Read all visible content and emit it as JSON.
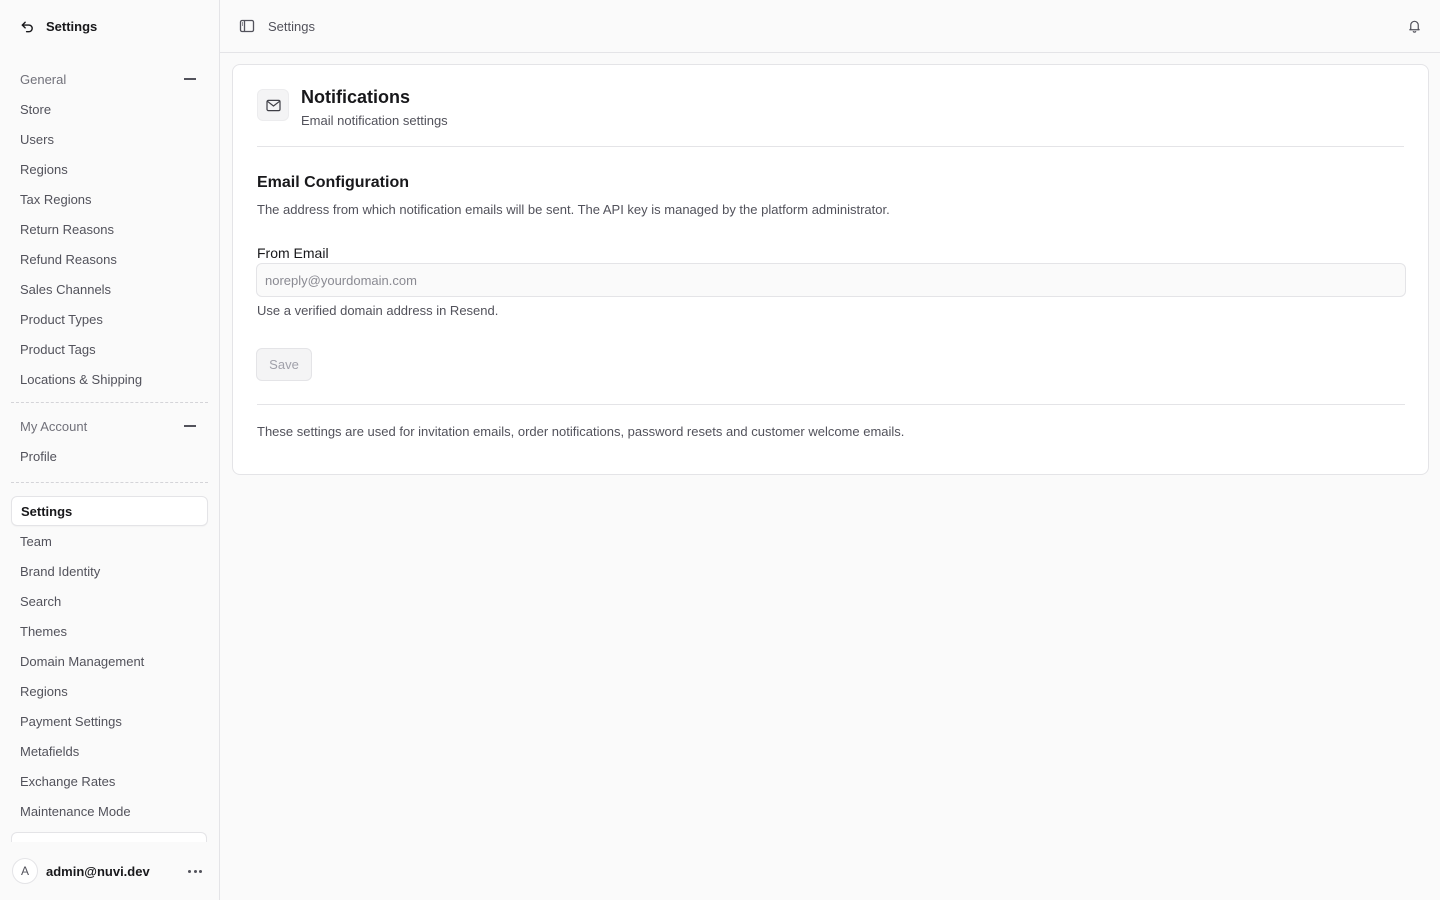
{
  "sidebar": {
    "title": "Settings",
    "groups": [
      {
        "label": "General",
        "items": [
          "Store",
          "Users",
          "Regions",
          "Tax Regions",
          "Return Reasons",
          "Refund Reasons",
          "Sales Channels",
          "Product Types",
          "Product Tags",
          "Locations & Shipping"
        ]
      },
      {
        "label": "My Account",
        "items": [
          "Profile"
        ]
      }
    ],
    "extra_items": [
      "Settings",
      "Team",
      "Brand Identity",
      "Search",
      "Themes",
      "Domain Management",
      "Regions",
      "Payment Settings",
      "Metafields",
      "Exchange Rates",
      "Maintenance Mode"
    ],
    "active_item": "Settings",
    "user": {
      "avatar_initial": "A",
      "email": "admin@nuvi.dev"
    }
  },
  "topbar": {
    "breadcrumb": "Settings"
  },
  "main": {
    "title": "Notifications",
    "subtitle": "Email notification settings",
    "section_title": "Email Configuration",
    "section_desc": "The address from which notification emails will be sent. The API key is managed by the platform administrator.",
    "from_email": {
      "label": "From Email",
      "value": "",
      "placeholder": "noreply@yourdomain.com",
      "hint": "Use a verified domain address in Resend."
    },
    "save_label": "Save",
    "footer_note": "These settings are used for invitation emails, order notifications, password resets and customer welcome emails."
  },
  "icons": {
    "back": "arrow-back-icon",
    "sidebar_toggle": "sidebar-toggle-icon",
    "bell": "bell-icon",
    "mail": "mail-icon",
    "collapse": "minus-icon",
    "more": "more-horizontal-icon"
  }
}
